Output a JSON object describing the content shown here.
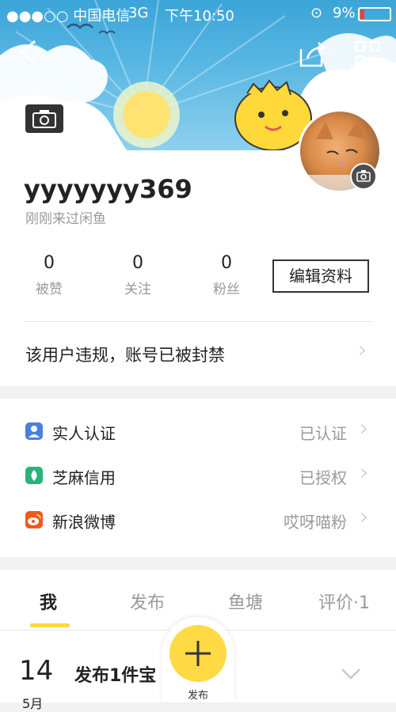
{
  "status_bar": {
    "carrier": "●●●○○ 中国电信",
    "network": "3G",
    "time": "下午10:50",
    "battery": "9%"
  },
  "profile": {
    "username": "yyyyyyy369",
    "subtitle": "刚刚来过闲鱼",
    "stats": [
      {
        "value": "0",
        "label": "被赞"
      },
      {
        "value": "0",
        "label": "关注"
      },
      {
        "value": "0",
        "label": "粉丝"
      }
    ],
    "edit_label": "编辑资料",
    "notice": "该用户违规，账号已被封禁"
  },
  "verifications": [
    {
      "label": "实人认证",
      "status": "已认证",
      "icon": "person-id-icon",
      "color": "#4a7ee0"
    },
    {
      "label": "芝麻信用",
      "status": "已授权",
      "icon": "sesame-credit-icon",
      "color": "#29b37a"
    },
    {
      "label": "新浪微博",
      "status": "哎呀喵粉",
      "icon": "weibo-icon",
      "color": "#f0581f"
    }
  ],
  "tabs": [
    "我",
    "发布",
    "鱼塘",
    "评价·1"
  ],
  "feed": {
    "day": "14",
    "month": "5月",
    "text": "发布1件宝"
  },
  "fab_label": "发布",
  "colors": {
    "accent": "#ffda44",
    "tab_underline": "#ffd83a"
  }
}
